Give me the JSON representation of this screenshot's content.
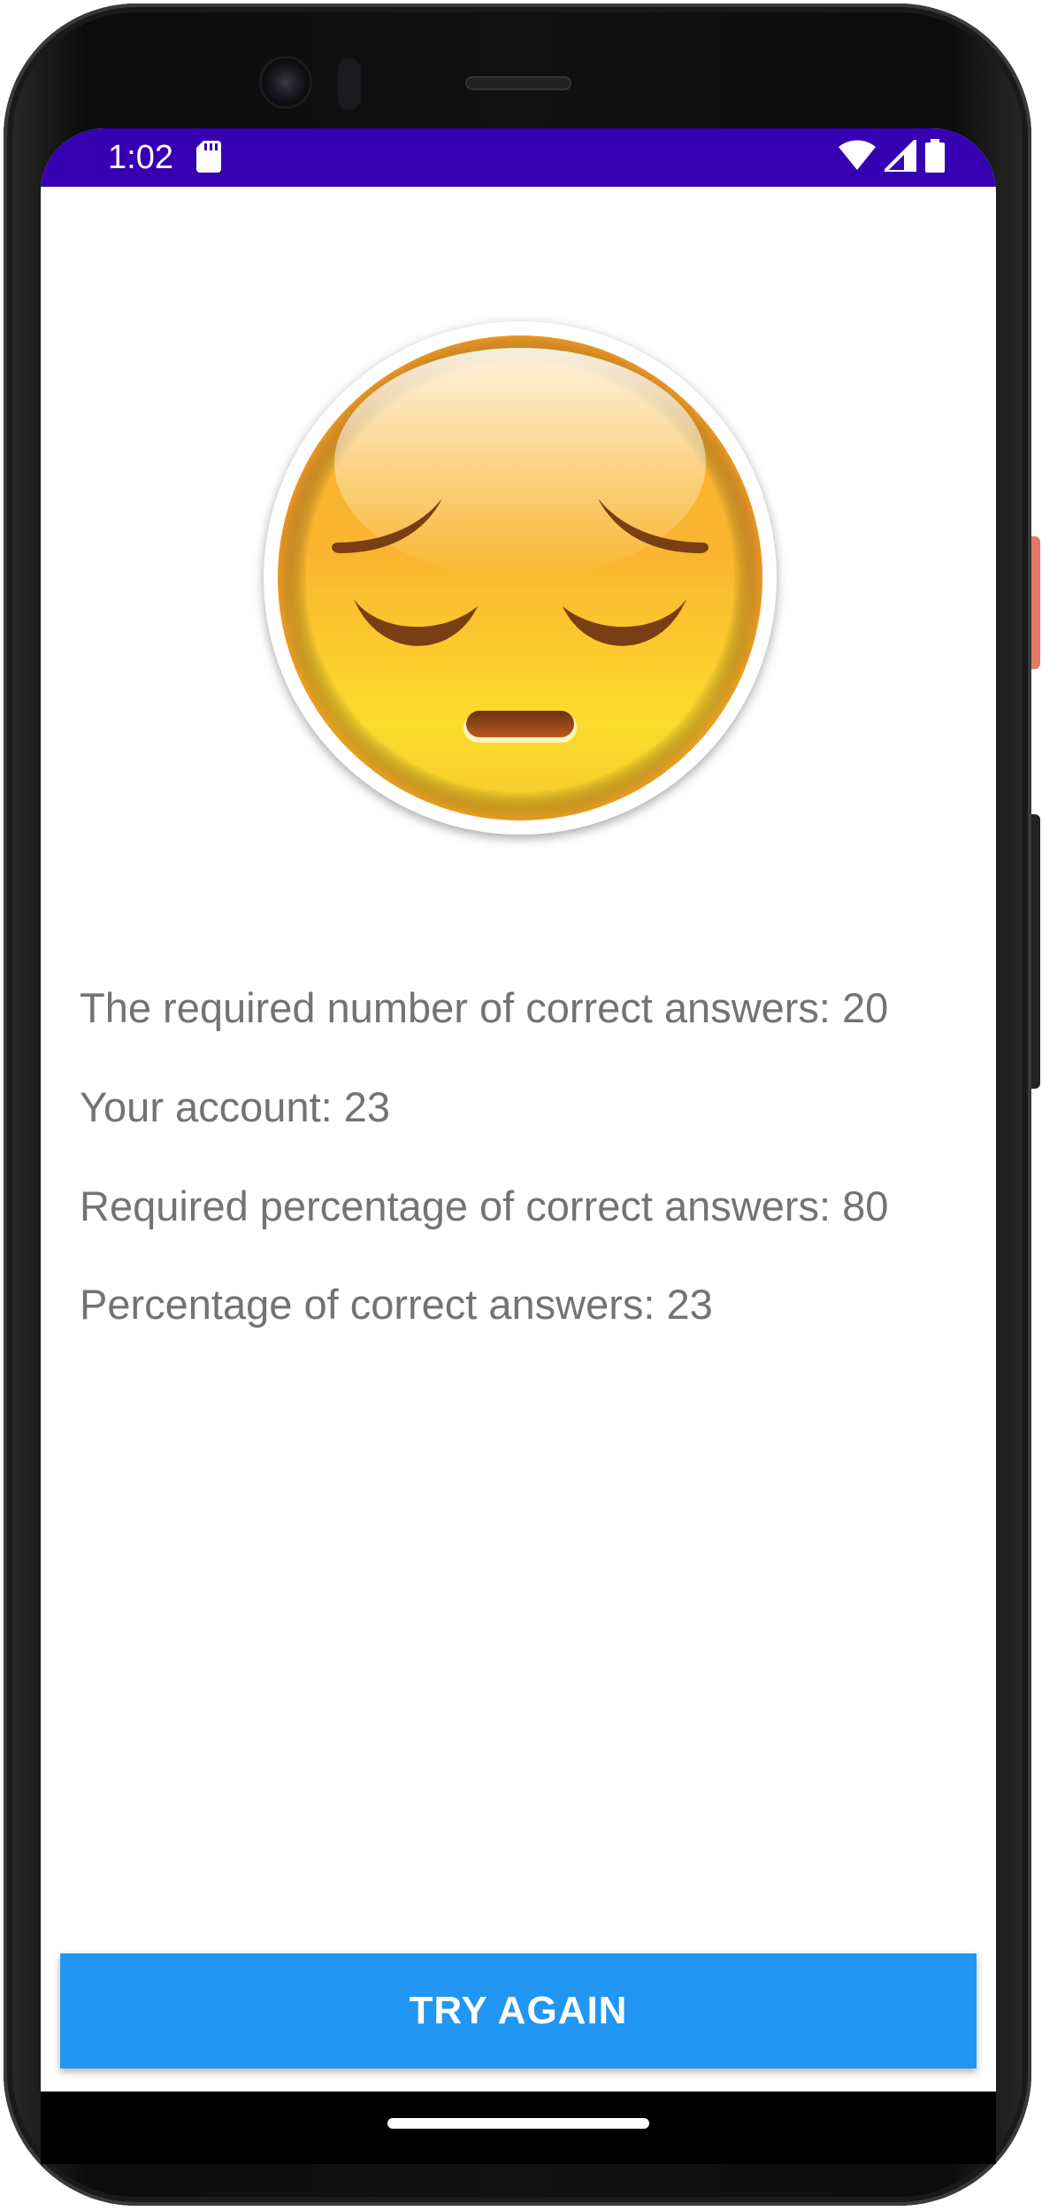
{
  "status_bar": {
    "time": "1:02",
    "background": "#3700b3",
    "icons": [
      "sd-card-icon",
      "wifi-icon",
      "signal-icon",
      "battery-icon"
    ]
  },
  "result_image": {
    "icon": "pensive-face-emoji"
  },
  "results": {
    "required_correct": "The required number of correct answers: 20",
    "your_account": "Your account: 23",
    "required_percentage": "Required percentage of correct answers: 80",
    "percentage_correct": "Percentage of correct answers: 23"
  },
  "actions": {
    "try_again_label": "TRY AGAIN",
    "button_color": "#2196f3"
  }
}
